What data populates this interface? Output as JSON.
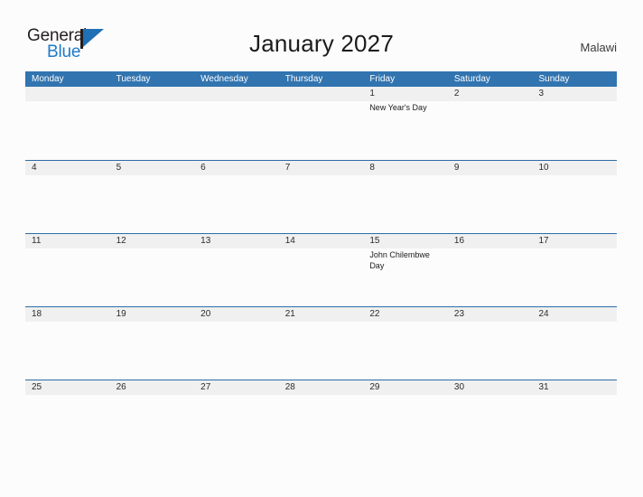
{
  "brand": {
    "word_one": "General",
    "word_two": "Blue",
    "accent_color": "#1f6fb5"
  },
  "header": {
    "title": "January 2027",
    "country": "Malawi"
  },
  "calendar": {
    "header_color": "#3174b0",
    "band_color": "#f0f0f0",
    "weekdays": [
      "Monday",
      "Tuesday",
      "Wednesday",
      "Thursday",
      "Friday",
      "Saturday",
      "Sunday"
    ],
    "weeks": [
      [
        {
          "num": "",
          "events": []
        },
        {
          "num": "",
          "events": []
        },
        {
          "num": "",
          "events": []
        },
        {
          "num": "",
          "events": []
        },
        {
          "num": "1",
          "events": [
            "New Year's Day"
          ]
        },
        {
          "num": "2",
          "events": []
        },
        {
          "num": "3",
          "events": []
        }
      ],
      [
        {
          "num": "4",
          "events": []
        },
        {
          "num": "5",
          "events": []
        },
        {
          "num": "6",
          "events": []
        },
        {
          "num": "7",
          "events": []
        },
        {
          "num": "8",
          "events": []
        },
        {
          "num": "9",
          "events": []
        },
        {
          "num": "10",
          "events": []
        }
      ],
      [
        {
          "num": "11",
          "events": []
        },
        {
          "num": "12",
          "events": []
        },
        {
          "num": "13",
          "events": []
        },
        {
          "num": "14",
          "events": []
        },
        {
          "num": "15",
          "events": [
            "John Chilembwe Day"
          ]
        },
        {
          "num": "16",
          "events": []
        },
        {
          "num": "17",
          "events": []
        }
      ],
      [
        {
          "num": "18",
          "events": []
        },
        {
          "num": "19",
          "events": []
        },
        {
          "num": "20",
          "events": []
        },
        {
          "num": "21",
          "events": []
        },
        {
          "num": "22",
          "events": []
        },
        {
          "num": "23",
          "events": []
        },
        {
          "num": "24",
          "events": []
        }
      ],
      [
        {
          "num": "25",
          "events": []
        },
        {
          "num": "26",
          "events": []
        },
        {
          "num": "27",
          "events": []
        },
        {
          "num": "28",
          "events": []
        },
        {
          "num": "29",
          "events": []
        },
        {
          "num": "30",
          "events": []
        },
        {
          "num": "31",
          "events": []
        }
      ]
    ]
  }
}
